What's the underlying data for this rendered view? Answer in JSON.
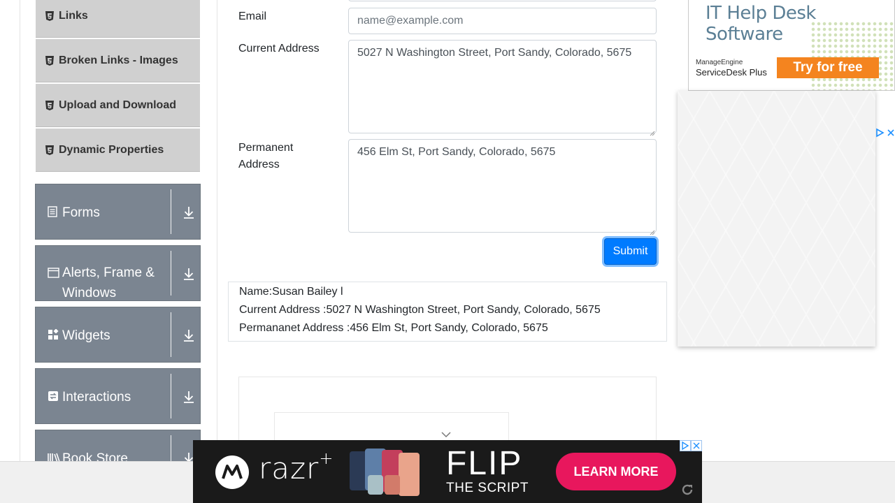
{
  "sidebar": {
    "sub_items": [
      {
        "label": "Links"
      },
      {
        "label": "Broken Links - Images"
      },
      {
        "label": "Upload and Download"
      },
      {
        "label": "Dynamic Properties"
      }
    ],
    "groups": [
      {
        "label": "Forms",
        "icon": "form-icon"
      },
      {
        "label": "Alerts, Frame & Windows",
        "icon": "window-icon"
      },
      {
        "label": "Widgets",
        "icon": "widgets-icon"
      },
      {
        "label": "Interactions",
        "icon": "interactions-icon"
      },
      {
        "label": "Book Store",
        "icon": "book-icon"
      }
    ]
  },
  "form": {
    "email_label": "Email",
    "email_placeholder": "name@example.com",
    "email_value": "",
    "current_address_label": "Current Address",
    "current_address_value": "5027 N Washington Street, Port Sandy, Colorado, 5675",
    "permanent_address_label": "Permanent Address",
    "permanent_address_value": "456 Elm St, Port Sandy, Colorado, 5675",
    "submit_label": "Submit"
  },
  "output": {
    "name": "Name:Susan Bailey l",
    "current_address": "Current Address :5027 N Washington Street, Port Sandy, Colorado, 5675",
    "permanent_address": "Permananet Address :456 Elm St, Port Sandy, Colorado, 5675"
  },
  "ad_top": {
    "title": "IT Help Desk Software",
    "brand_line1": "ManageEngine",
    "brand_line2": "ServiceDesk Plus",
    "cta": "Try for free"
  },
  "ad_bottom": {
    "brand": "razr",
    "brand_sup": "+",
    "headline": "FLIP",
    "subline": "THE SCRIPT",
    "cta": "LEARN MORE"
  },
  "colors": {
    "primary": "#007bff",
    "sidebar_group": "#7b8591",
    "sidebar_subitem": "#d0d0d0",
    "ad_cta_orange": "#f4841f",
    "ad_cta_pink": "#e8175d"
  }
}
